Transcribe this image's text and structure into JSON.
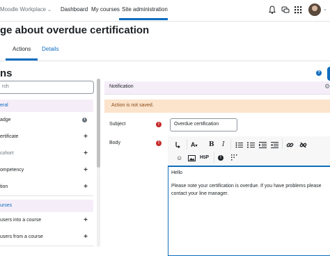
{
  "navbar": {
    "brand": "Moodle Workplace",
    "links": [
      "Dashboard",
      "My courses",
      "Site administration"
    ],
    "icons": [
      "bell-icon",
      "chat-icon",
      "grid-icon"
    ]
  },
  "page": {
    "title": "ge about overdue certification",
    "tabs": [
      "Actions",
      "Details"
    ],
    "section_title": "ns"
  },
  "left_panel": {
    "search_placeholder": "rch",
    "category_general": "eral",
    "general_items": [
      {
        "label": "adge",
        "action": "info"
      },
      {
        "label": "ertificate",
        "action": "add"
      },
      {
        "label": "cohort",
        "action": "add"
      },
      {
        "label": "ompetency",
        "action": "add"
      },
      {
        "label": "tion",
        "action": "add"
      }
    ],
    "category_courses": "urses",
    "course_items": [
      {
        "label": "users into a course",
        "action": "add"
      },
      {
        "label": "users from a course",
        "action": "add"
      }
    ]
  },
  "right_panel": {
    "header": "Notification",
    "alert": "Action is not saved.",
    "subject_label": "Subject",
    "subject_value": "Overdue certification",
    "body_label": "Body",
    "body_lines": [
      "Hello",
      "Please note your certification is overdue. If you have problems please",
      "contact your line manager."
    ]
  },
  "colors": {
    "accent": "#0f6cbf",
    "alert_bg": "#fbe3cc",
    "required": "#c62828",
    "category_bg": "#f5eef8"
  }
}
